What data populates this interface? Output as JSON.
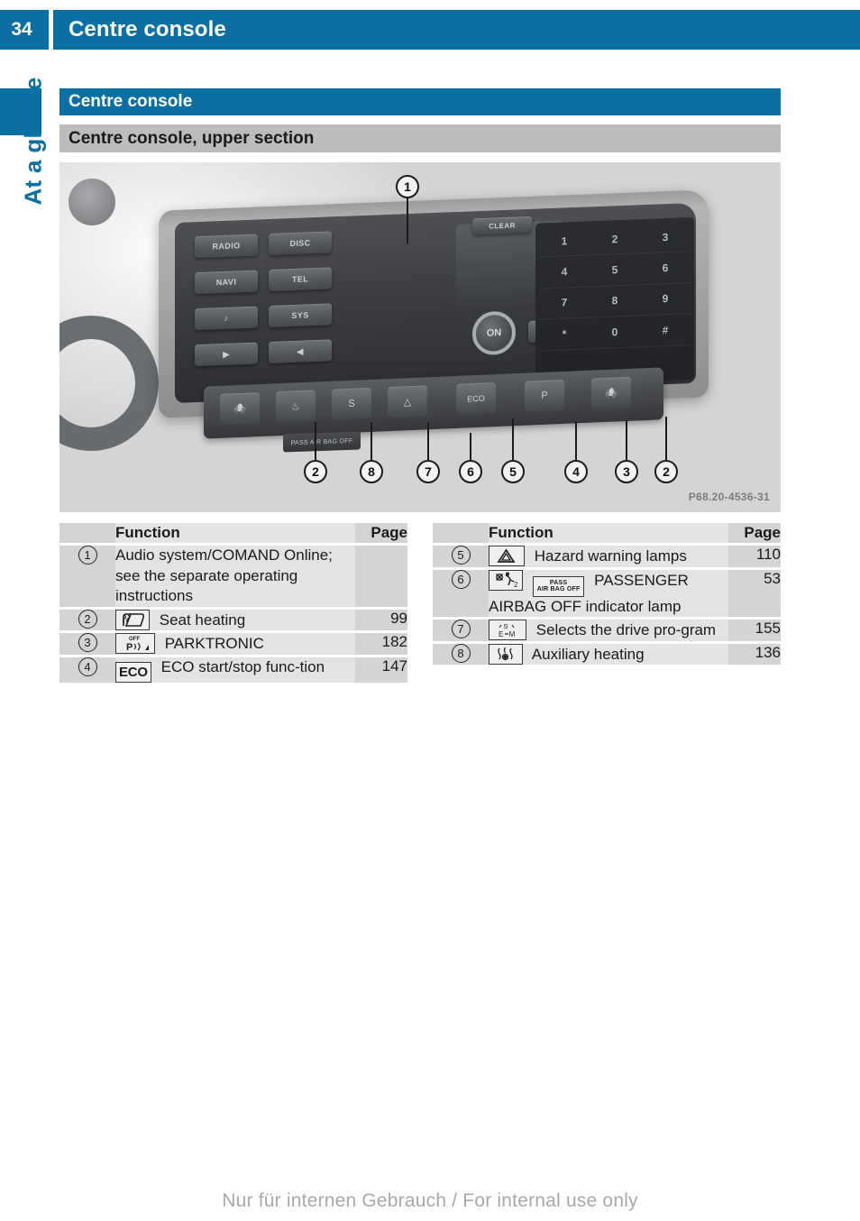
{
  "header": {
    "page_number": "34",
    "running_title": "Centre console"
  },
  "chapter_tab": {
    "label": "At a glance"
  },
  "section": {
    "title": "Centre console",
    "subtitle": "Centre console, upper section"
  },
  "illustration": {
    "figure_reference": "P68.20-4536-31",
    "radio_buttons": [
      "RADIO",
      "DISC",
      "NAVI",
      "TEL",
      "♪",
      "SYS",
      "▶",
      "◀"
    ],
    "clear_label": "CLEAR",
    "knob_label": "ON",
    "seek_label": "▶▶",
    "keypad_keys": [
      "1",
      "2",
      "3",
      "4",
      "5",
      "6",
      "7",
      "8",
      "9",
      "*",
      "0",
      "#"
    ],
    "eco_switch_label": "ECO",
    "airbag_indicator_label": "PASS AIR BAG OFF",
    "callouts": [
      "1",
      "2",
      "8",
      "7",
      "6",
      "5",
      "4",
      "3",
      "2"
    ]
  },
  "legend": {
    "columns": {
      "number": "",
      "function": "Function",
      "page": "Page"
    },
    "left_rows": [
      {
        "number": "1",
        "icon": "none",
        "function": "Audio system/COMAND Online; see the separate operating instructions",
        "page": ""
      },
      {
        "number": "2",
        "icon": "seat-heating-icon",
        "function": "Seat heating",
        "page": "99"
      },
      {
        "number": "3",
        "icon": "parktronic-icon",
        "function": "PARKTRONIC",
        "page": "182"
      },
      {
        "number": "4",
        "icon": "eco-icon",
        "icon_text": "ECO",
        "function": "ECO start/stop func‑tion",
        "page": "147"
      }
    ],
    "right_rows": [
      {
        "number": "5",
        "icon": "hazard-warning-icon",
        "function": "Hazard warning lamps",
        "page": "110"
      },
      {
        "number": "6",
        "icon": "passenger-airbag-off-icon",
        "icon_text_line1": "PASS",
        "icon_text_line2": "AIR BAG OFF",
        "function": "PASSENGER AIRBAG OFF indicator lamp",
        "page": "53"
      },
      {
        "number": "7",
        "icon": "drive-program-icon",
        "function": "Selects the drive pro‑gram",
        "page": "155"
      },
      {
        "number": "8",
        "icon": "auxiliary-heating-icon",
        "function": "Auxiliary heating",
        "page": "136"
      }
    ]
  },
  "footer": {
    "watermark": "Nur für internen Gebrauch / For internal use only"
  },
  "colors": {
    "brand_blue": "#0a6fa3",
    "subsection_gray": "#bcbcbc",
    "cell_gray": "#d4d4d4",
    "cell_light_gray": "#e3e3e3"
  }
}
